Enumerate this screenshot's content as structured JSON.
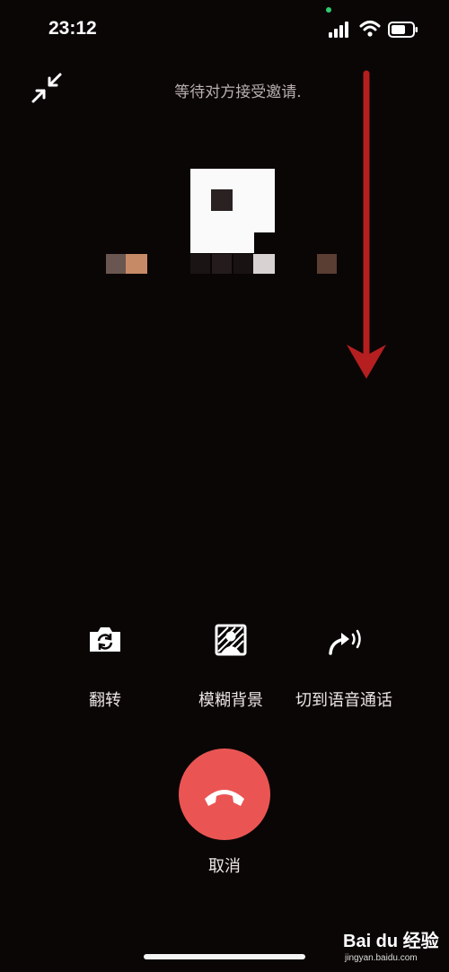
{
  "status_bar": {
    "time": "23:12"
  },
  "call": {
    "status_text": "等待对方接受邀请.",
    "controls": [
      {
        "label": "翻转",
        "icon": "camera-flip-icon"
      },
      {
        "label": "模糊背景",
        "icon": "blur-background-icon"
      },
      {
        "label": "切到语音通话",
        "icon": "switch-to-voice-icon"
      }
    ],
    "cancel_label": "取消"
  },
  "colors": {
    "background": "#0b0606",
    "hangup": "#ea5553",
    "annotation_arrow": "#b51f1f"
  },
  "watermark": {
    "logo": "Bai du 经验",
    "url": "jingyan.baidu.com"
  }
}
